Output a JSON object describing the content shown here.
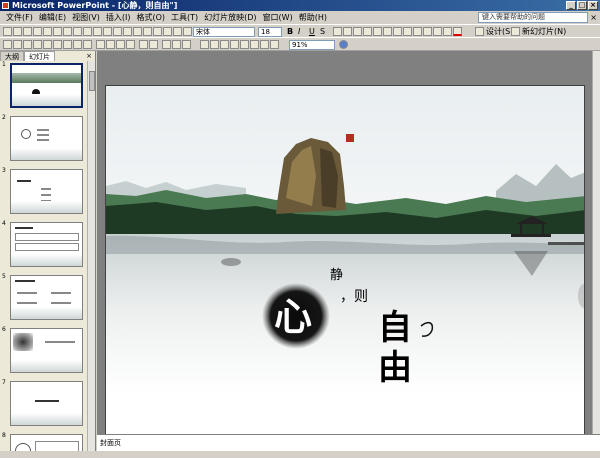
{
  "window": {
    "title": "Microsoft PowerPoint - [心静，则自由\"]"
  },
  "menu": {
    "items": [
      "文件(F)",
      "编辑(E)",
      "视图(V)",
      "插入(I)",
      "格式(O)",
      "工具(T)",
      "幻灯片放映(D)",
      "窗口(W)",
      "帮助(H)"
    ],
    "help_placeholder": "键入需要帮助的问题",
    "close_doc": "×"
  },
  "toolbar": {
    "font_name": "宋体",
    "font_size": "18",
    "bold": "B",
    "italic": "I",
    "underline": "U",
    "shadow": "S",
    "design_label": "设计(S)",
    "new_slide_label": "新幻灯片(N)",
    "zoom": "91%"
  },
  "panel": {
    "tabs": [
      "大纲",
      "幻灯片"
    ],
    "close": "×",
    "slide_numbers": [
      "1",
      "2",
      "3",
      "4",
      "5",
      "6",
      "7",
      "8"
    ]
  },
  "slide": {
    "jing": "静",
    "comma_ze": "，则",
    "xin": "心",
    "zi": "自",
    "you": "由"
  },
  "notes": {
    "text": "封面页"
  },
  "colors": {
    "title_bar": "#0a246a",
    "slide_bg": "#ffffff",
    "workspace": "#808080",
    "ink": "#111111"
  }
}
